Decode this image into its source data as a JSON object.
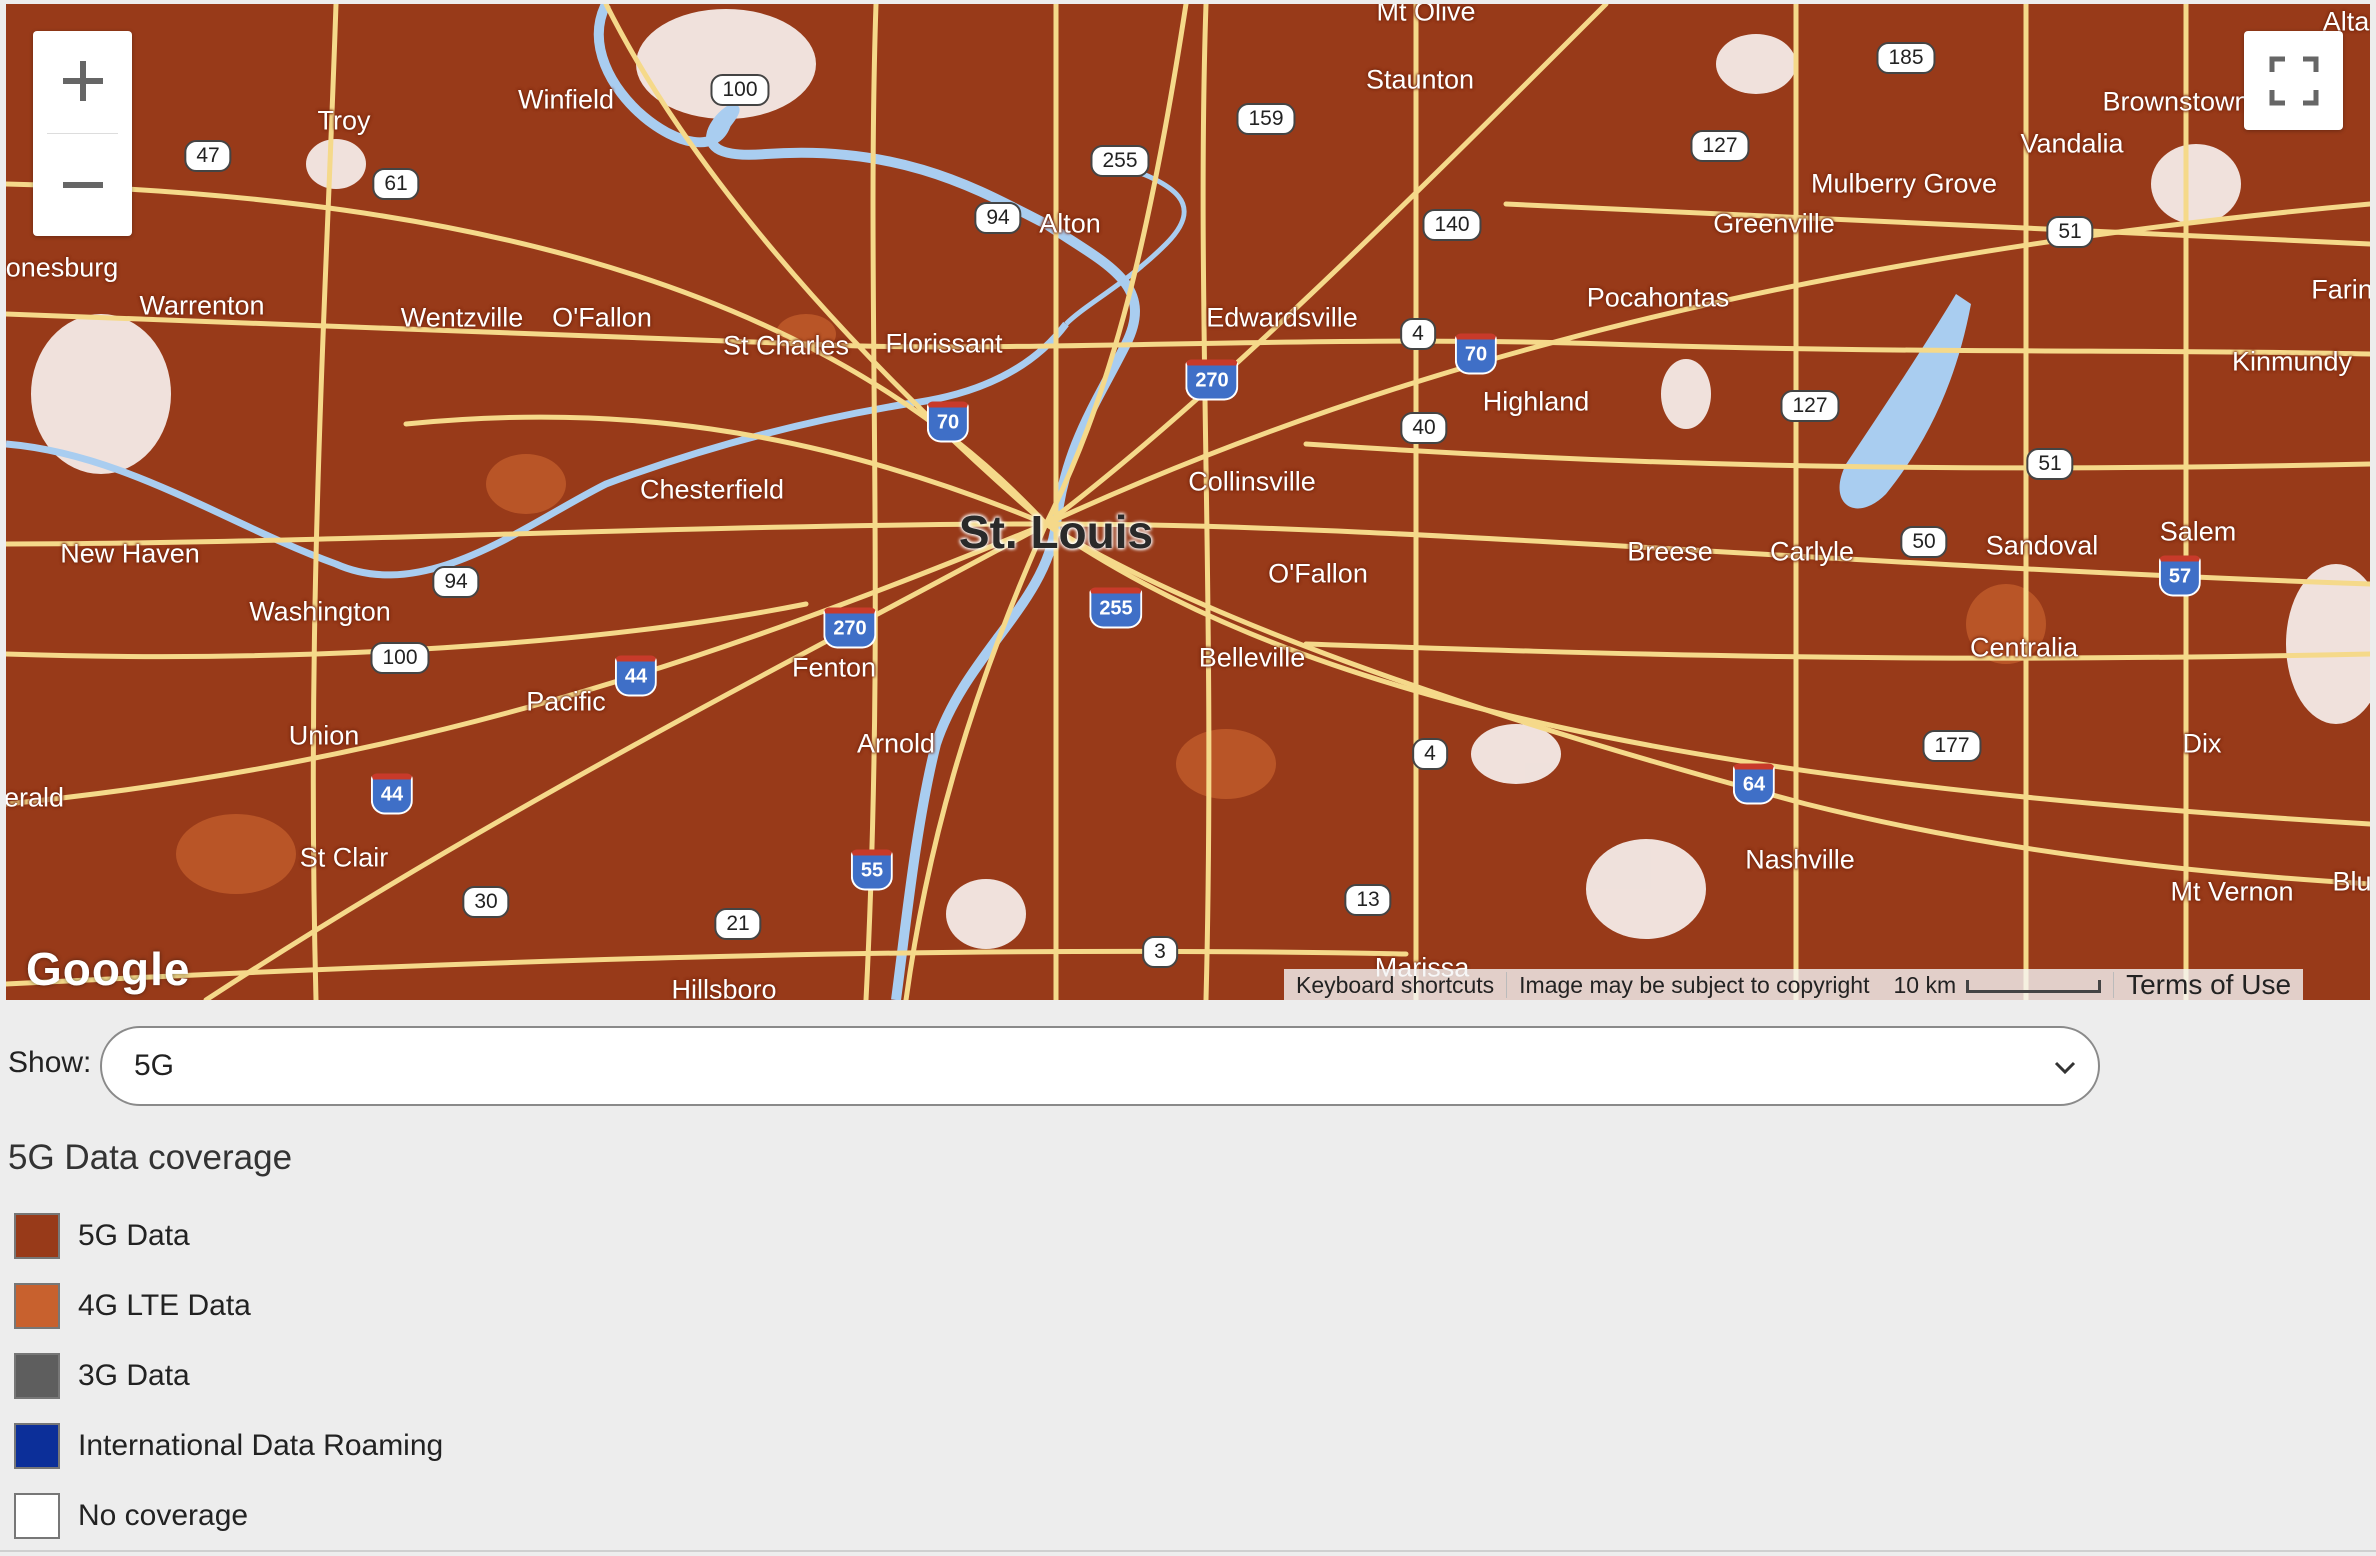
{
  "map": {
    "city_major": "St. Louis",
    "places": [
      "Mt Olive",
      "Staunton",
      "Alta",
      "Troy",
      "Winfield",
      "Brownstown",
      "Vandalia",
      "Mulberry Grove",
      "Greenville",
      "onesburg",
      "Warrenton",
      "Wentzville",
      "O'Fallon",
      "St Charles",
      "Florissant",
      "Alton",
      "Edwardsville",
      "Pocahontas",
      "Farin",
      "Kinmundy",
      "Highland",
      "Chesterfield",
      "Collinsville",
      "New Haven",
      "Breese",
      "Carlyle",
      "Sandoval",
      "Salem",
      "Washington",
      "O'Fallon",
      "Fenton",
      "Belleville",
      "Centralia",
      "Pacific",
      "Union",
      "Arnold",
      "Dix",
      "erald",
      "St Clair",
      "Nashville",
      "Mt Vernon",
      "Blu",
      "Hillsboro",
      "Marissa"
    ],
    "us_routes": [
      "185",
      "100",
      "159",
      "255",
      "127",
      "47",
      "61",
      "94",
      "140",
      "51",
      "4",
      "127",
      "40",
      "51",
      "50",
      "94",
      "100",
      "177",
      "4",
      "13",
      "30",
      "21",
      "3"
    ],
    "interstates": [
      "270",
      "70",
      "70",
      "270",
      "255",
      "44",
      "44",
      "57",
      "64",
      "55"
    ],
    "google_logo": "Google",
    "attribution": {
      "keyboard": "Keyboard shortcuts",
      "copyright": "Image may be subject to copyright",
      "scale": "10 km",
      "terms": "Terms of Use"
    },
    "colors": {
      "coverage_5g": "#983a19",
      "roads": "#f5d98a",
      "water": "#a9cdf0"
    }
  },
  "controls": {
    "zoom_in_icon": "plus-icon",
    "zoom_out_icon": "minus-icon",
    "fullscreen_icon": "fullscreen-icon"
  },
  "filter": {
    "label": "Show:",
    "selected": "5G"
  },
  "legend": {
    "title": "5G Data coverage",
    "items": [
      {
        "label": "5G Data",
        "color": "#983a19"
      },
      {
        "label": "4G LTE Data",
        "color": "#c8612e"
      },
      {
        "label": "3G Data",
        "color": "#5e5e5e"
      },
      {
        "label": "International Data Roaming",
        "color": "#0c2f99"
      },
      {
        "label": "No coverage",
        "color": "#ffffff"
      }
    ]
  }
}
